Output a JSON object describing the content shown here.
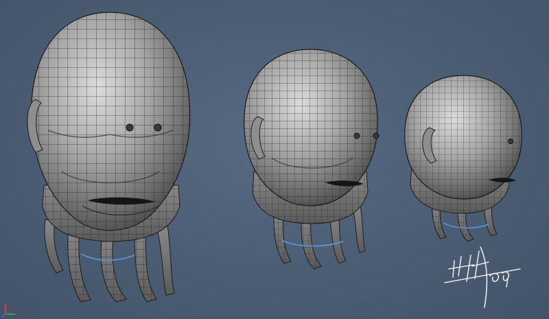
{
  "viewport": {
    "background": "#4b5d73",
    "mesh_fill": "#9a9a9a",
    "wire_color": "#1c1c1c",
    "accent_blue": "#5a8fd0"
  },
  "models": [
    {
      "id": "head-large"
    },
    {
      "id": "head-medium"
    },
    {
      "id": "head-small"
    }
  ],
  "signature": {
    "text": "",
    "year_mark": ""
  },
  "axis_gizmo": {
    "x_color": "#d04040",
    "y_color": "#40a040",
    "z_color": "#4060d0"
  },
  "icons": [
    "viewport-axis-gizmo-icon",
    "artist-signature-mark"
  ]
}
